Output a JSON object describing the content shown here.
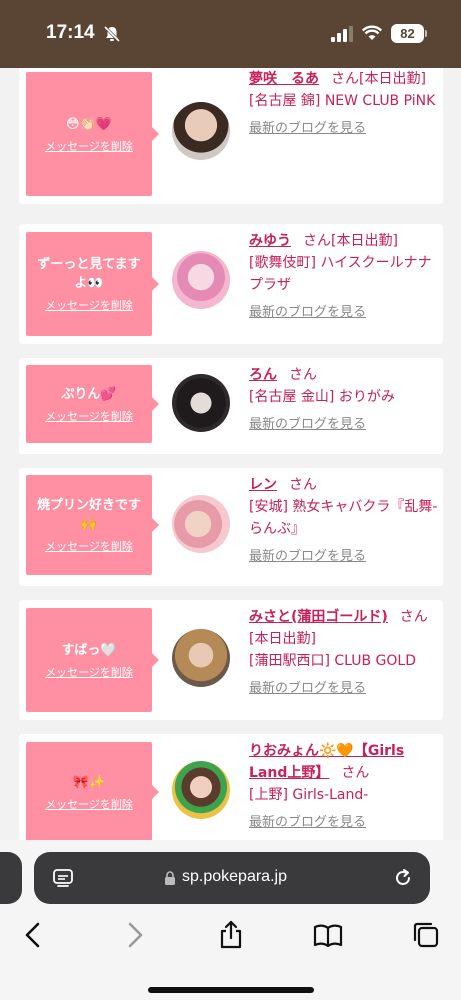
{
  "status": {
    "time": "17:14",
    "battery": "82"
  },
  "browser": {
    "url": "sp.pokepara.jp"
  },
  "feed": {
    "delete_label": "メッセージを削除",
    "blog_label": "最新のブログを見る",
    "san": "さん",
    "items": [
      {
        "message": "😳👏🏻💗",
        "name": "夢咲　るあ",
        "status": "[本日出勤]",
        "shop": "[名古屋 錦] NEW CLUB PiNK"
      },
      {
        "message": "ずーっと見てますよ👀",
        "name": "みゆう",
        "status": "[本日出勤]",
        "shop": "[歌舞伎町] ハイスクールナナプラザ"
      },
      {
        "message": "ぷりん💕",
        "name": "ろん",
        "status": "",
        "shop": "[名古屋 金山] おりがみ"
      },
      {
        "message": "焼プリン好きです🙌",
        "name": "レン",
        "status": "",
        "shop": "[安城] 熟女キャバクラ『乱舞-らんぶ』"
      },
      {
        "message": "すばっ🤍",
        "name": "みさと(蒲田ゴールド)",
        "status": "[本日出勤]",
        "shop": "[蒲田駅西口] CLUB GOLD"
      },
      {
        "message": "🎀✨",
        "name": "りおみょん🔆🧡【Girls Land上野】",
        "status": "",
        "shop": "[上野] Girls-Land-"
      }
    ]
  }
}
